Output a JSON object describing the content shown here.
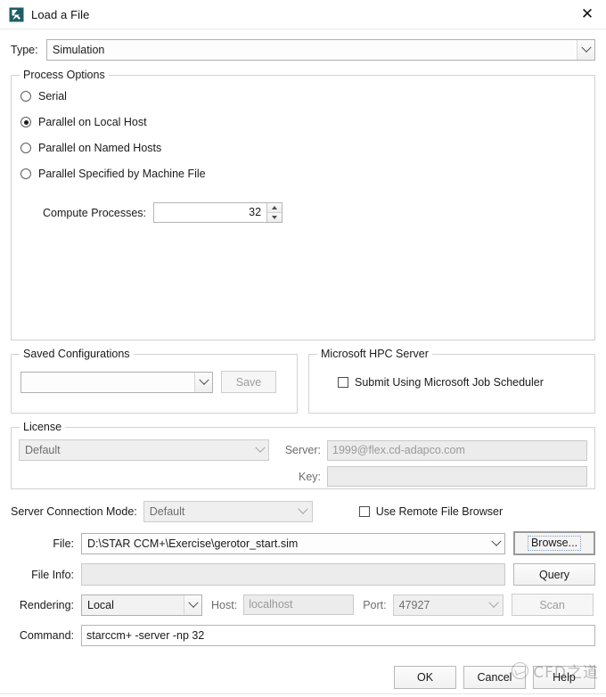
{
  "window": {
    "title": "Load a File",
    "icon": "star-ccm-logo-icon",
    "close_label": "✕"
  },
  "type_row": {
    "label": "Type:",
    "value": "Simulation"
  },
  "process_options": {
    "title": "Process Options",
    "radios": [
      {
        "label": "Serial",
        "selected": false
      },
      {
        "label": "Parallel on Local Host",
        "selected": true
      },
      {
        "label": "Parallel on Named Hosts",
        "selected": false
      },
      {
        "label": "Parallel Specified by Machine File",
        "selected": false
      }
    ],
    "compute_processes": {
      "label": "Compute Processes:",
      "value": "32"
    }
  },
  "saved_configurations": {
    "title": "Saved Configurations",
    "combo_value": "",
    "save_label": "Save"
  },
  "hpc_server": {
    "title": "Microsoft HPC Server",
    "checkbox_label": "Submit Using Microsoft Job Scheduler",
    "checked": false
  },
  "license": {
    "title": "License",
    "combo_value": "Default",
    "server_label": "Server:",
    "server_value": "1999@flex.cd-adapco.com",
    "key_label": "Key:",
    "key_value": ""
  },
  "connection": {
    "mode_label": "Server Connection Mode:",
    "mode_value": "Default",
    "remote_browser_label": "Use Remote File Browser",
    "remote_browser_checked": false
  },
  "file_row": {
    "label": "File:",
    "value": "D:\\STAR CCM+\\Exercise\\gerotor_start.sim",
    "browse_label": "Browse..."
  },
  "file_info_row": {
    "label": "File Info:",
    "value": "",
    "query_label": "Query"
  },
  "rendering_row": {
    "label": "Rendering:",
    "value": "Local",
    "host_label": "Host:",
    "host_value": "localhost",
    "port_label": "Port:",
    "port_value": "47927",
    "scan_label": "Scan"
  },
  "command_row": {
    "label": "Command:",
    "value": "starccm+ -server -np 32"
  },
  "footer": {
    "ok_label": "OK",
    "cancel_label": "Cancel",
    "help_label": "Help"
  },
  "watermark": {
    "text": "CFD之道"
  },
  "colors": {
    "accent": "#1f5d66",
    "window_bg": "#ffffff",
    "group_border": "#d2d2d2",
    "disabled_bg": "#ececec"
  }
}
